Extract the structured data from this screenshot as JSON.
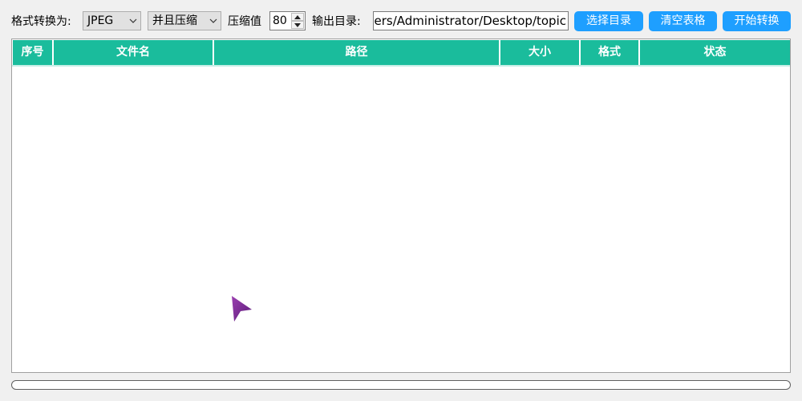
{
  "toolbar": {
    "format_label": "格式转换为:",
    "format_value": "JPEG",
    "mode_value": "并且压缩",
    "quality_label": "压缩值",
    "quality_value": "80",
    "output_label": "输出目录:",
    "output_path": "C:/Users/Administrator/Desktop/topic",
    "choose_dir_label": "选择目录",
    "clear_table_label": "清空表格",
    "start_label": "开始转换"
  },
  "table": {
    "headers": [
      "序号",
      "文件名",
      "路径",
      "大小",
      "格式",
      "状态"
    ],
    "rows": []
  },
  "progress": {
    "value": 0
  },
  "colors": {
    "header_bg": "#1abc9c",
    "button_bg": "#1e9fff",
    "cursor": "#7b2d8e"
  },
  "icons": {
    "combo_arrow": "chevron-down-icon",
    "spin_up": "caret-up-icon",
    "spin_down": "caret-down-icon",
    "cursor": "arrow-cursor-icon"
  }
}
